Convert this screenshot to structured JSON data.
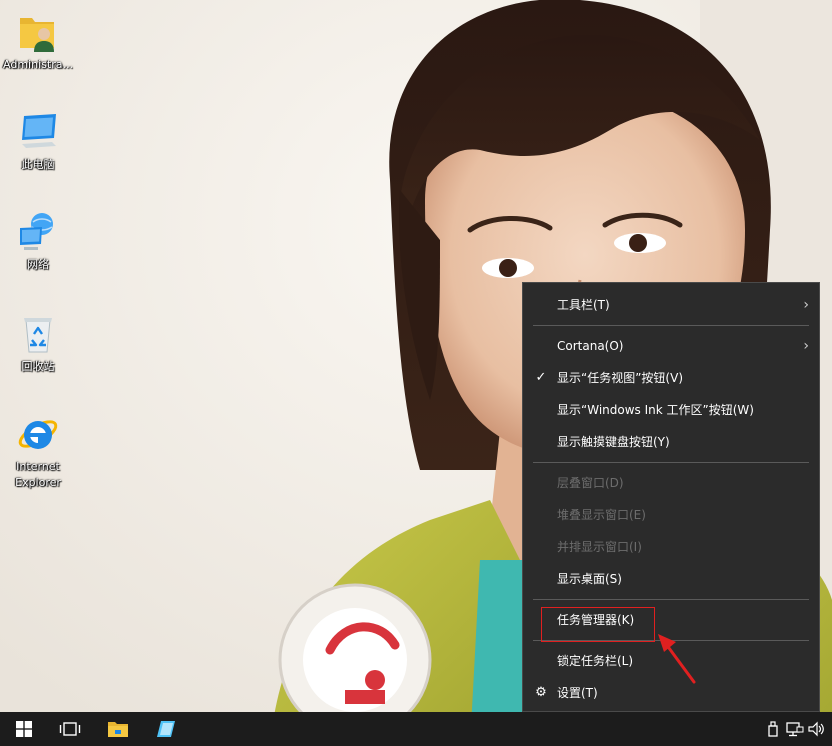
{
  "desktop": {
    "icons": [
      {
        "label": "Administra...",
        "icon": "user-folder-icon"
      },
      {
        "label": "此电脑",
        "icon": "this-pc-icon"
      },
      {
        "label": "网络",
        "icon": "network-icon"
      },
      {
        "label": "回收站",
        "icon": "recycle-bin-icon"
      },
      {
        "label": "Internet\nExplorer",
        "icon": "internet-explorer-icon"
      }
    ]
  },
  "context_menu": {
    "items": [
      {
        "label": "工具栏(T)",
        "submenu": true
      },
      {
        "label": "Cortana(O)",
        "submenu": true
      },
      {
        "label": "显示“任务视图”按钮(V)",
        "checked": true
      },
      {
        "label": "显示“Windows Ink 工作区”按钮(W)"
      },
      {
        "label": "显示触摸键盘按钮(Y)"
      },
      {
        "label": "层叠窗口(D)",
        "disabled": true
      },
      {
        "label": "堆叠显示窗口(E)",
        "disabled": true
      },
      {
        "label": "并排显示窗口(I)",
        "disabled": true
      },
      {
        "label": "显示桌面(S)"
      },
      {
        "label": "任务管理器(K)",
        "highlighted": true
      },
      {
        "label": "锁定任务栏(L)"
      },
      {
        "label": "设置(T)",
        "icon": "gear-icon"
      }
    ],
    "check_glyph": "✓",
    "arrow_glyph": "›",
    "gear_glyph": "⚙"
  },
  "annotation": {
    "color": "#e02020"
  },
  "taskbar": {
    "buttons": [
      "start-windows-icon",
      "task-view-icon",
      "file-explorer-icon",
      "pinned-app-icon"
    ],
    "tray": [
      "usb-icon",
      "network-tray-icon",
      "volume-icon"
    ]
  }
}
